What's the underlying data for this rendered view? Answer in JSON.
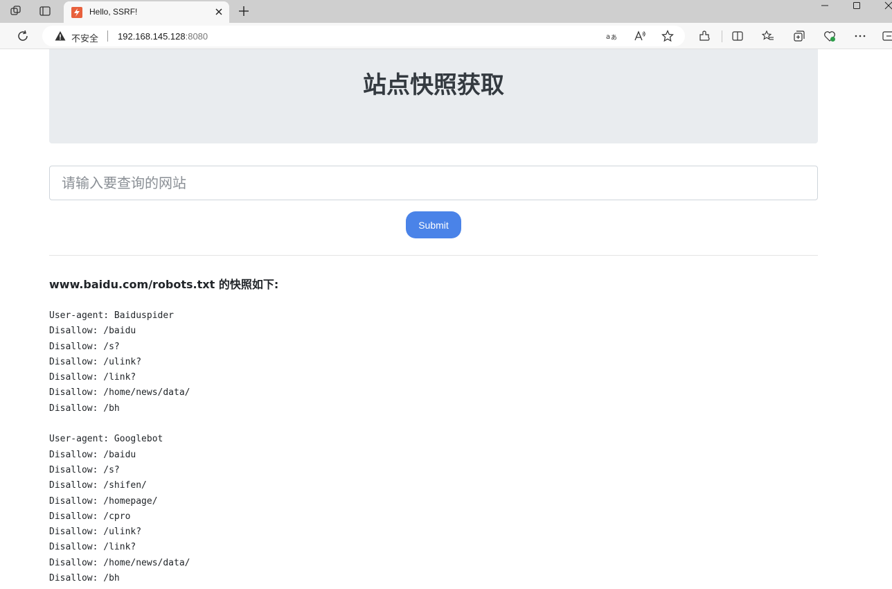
{
  "browser": {
    "tab_title": "Hello, SSRF!",
    "security_label": "不安全",
    "url_host": "192.168.145.128",
    "url_port": ":8080"
  },
  "page": {
    "title": "站点快照获取",
    "search_placeholder": "请输入要查询的网站",
    "submit_label": "Submit",
    "result_heading": "www.baidu.com/robots.txt 的快照如下:",
    "robots_lines": [
      "User-agent: Baiduspider",
      "Disallow: /baidu",
      "Disallow: /s?",
      "Disallow: /ulink?",
      "Disallow: /link?",
      "Disallow: /home/news/data/",
      "Disallow: /bh",
      "",
      "User-agent: Googlebot",
      "Disallow: /baidu",
      "Disallow: /s?",
      "Disallow: /shifen/",
      "Disallow: /homepage/",
      "Disallow: /cpro",
      "Disallow: /ulink?",
      "Disallow: /link?",
      "Disallow: /home/news/data/",
      "Disallow: /bh"
    ]
  },
  "colors": {
    "hero_bg": "#e9ecef",
    "submit_bg": "#4a83e8",
    "tabstrip_bg": "#cfcfcf"
  }
}
